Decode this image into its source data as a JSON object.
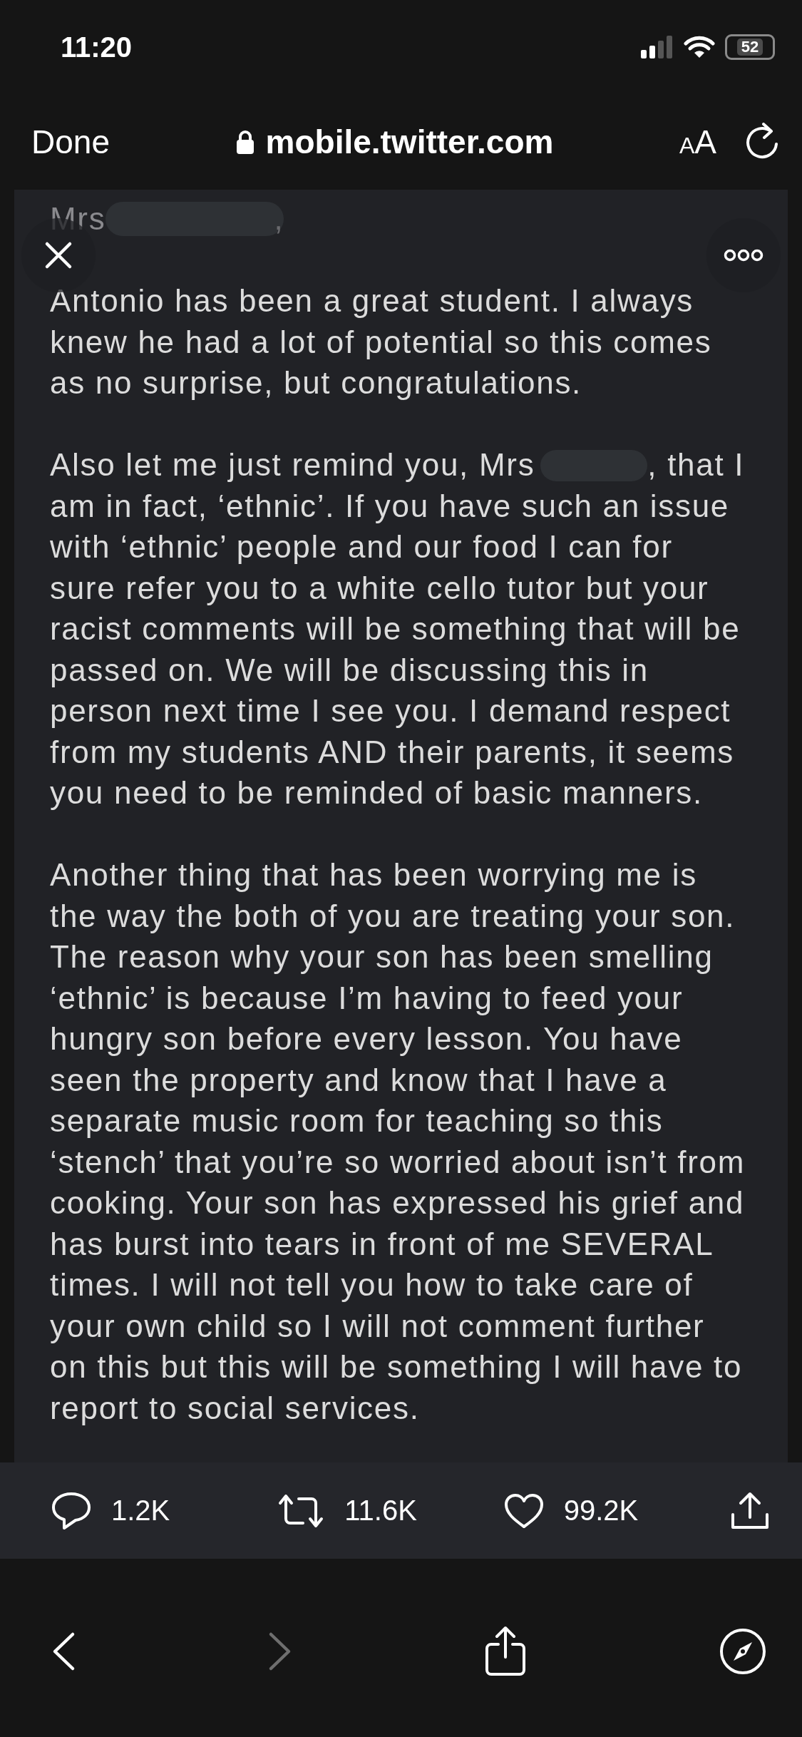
{
  "status_bar": {
    "time": "11:20",
    "battery": "52"
  },
  "browser": {
    "done": "Done",
    "url": "mobile.twitter.com",
    "text_size": "AA"
  },
  "document": {
    "greeting": {
      "before": "Mrs",
      "after": ","
    },
    "paragraphs": [
      {
        "kind": "plain",
        "text": "Antonio has been a great student. I always knew he had a lot of potential so this comes as no surprise, but congratulations."
      },
      {
        "kind": "redacted",
        "before": "Also let me just remind you, Mrs",
        "after": ", that I am in fact, ‘ethnic’. If you have such an issue with ‘ethnic’ people and our food I can for sure refer you to a white cello tutor but your racist comments will be something that will be passed on. We will be discussing this in person next time I see you. I demand respect from my students AND their parents, it seems you need to be reminded of basic manners."
      },
      {
        "kind": "plain",
        "text": "Another thing that has been worrying me is the way the both of you are treating your son. The reason why your son has been smelling ‘ethnic’ is because I’m having to feed your hungry son before every lesson. You have seen the property and know that I have a separate music room for teaching so this ‘stench’ that you’re so worried about isn’t from cooking. Your son has expressed his grief and has burst into tears in front of me SEVERAL times. I will not tell you how to take care of your own child so I will not comment further on this but this will be something I will have to report to social services."
      }
    ]
  },
  "actions": [
    {
      "kind": "reply",
      "count": "1.2K"
    },
    {
      "kind": "retweet",
      "count": "11.6K"
    },
    {
      "kind": "like",
      "count": "99.2K"
    },
    {
      "kind": "share"
    }
  ],
  "toolbar": [
    {
      "kind": "back",
      "disabled": false
    },
    {
      "kind": "forward",
      "disabled": true
    },
    {
      "kind": "share",
      "disabled": false
    },
    {
      "kind": "compass",
      "disabled": false
    }
  ]
}
